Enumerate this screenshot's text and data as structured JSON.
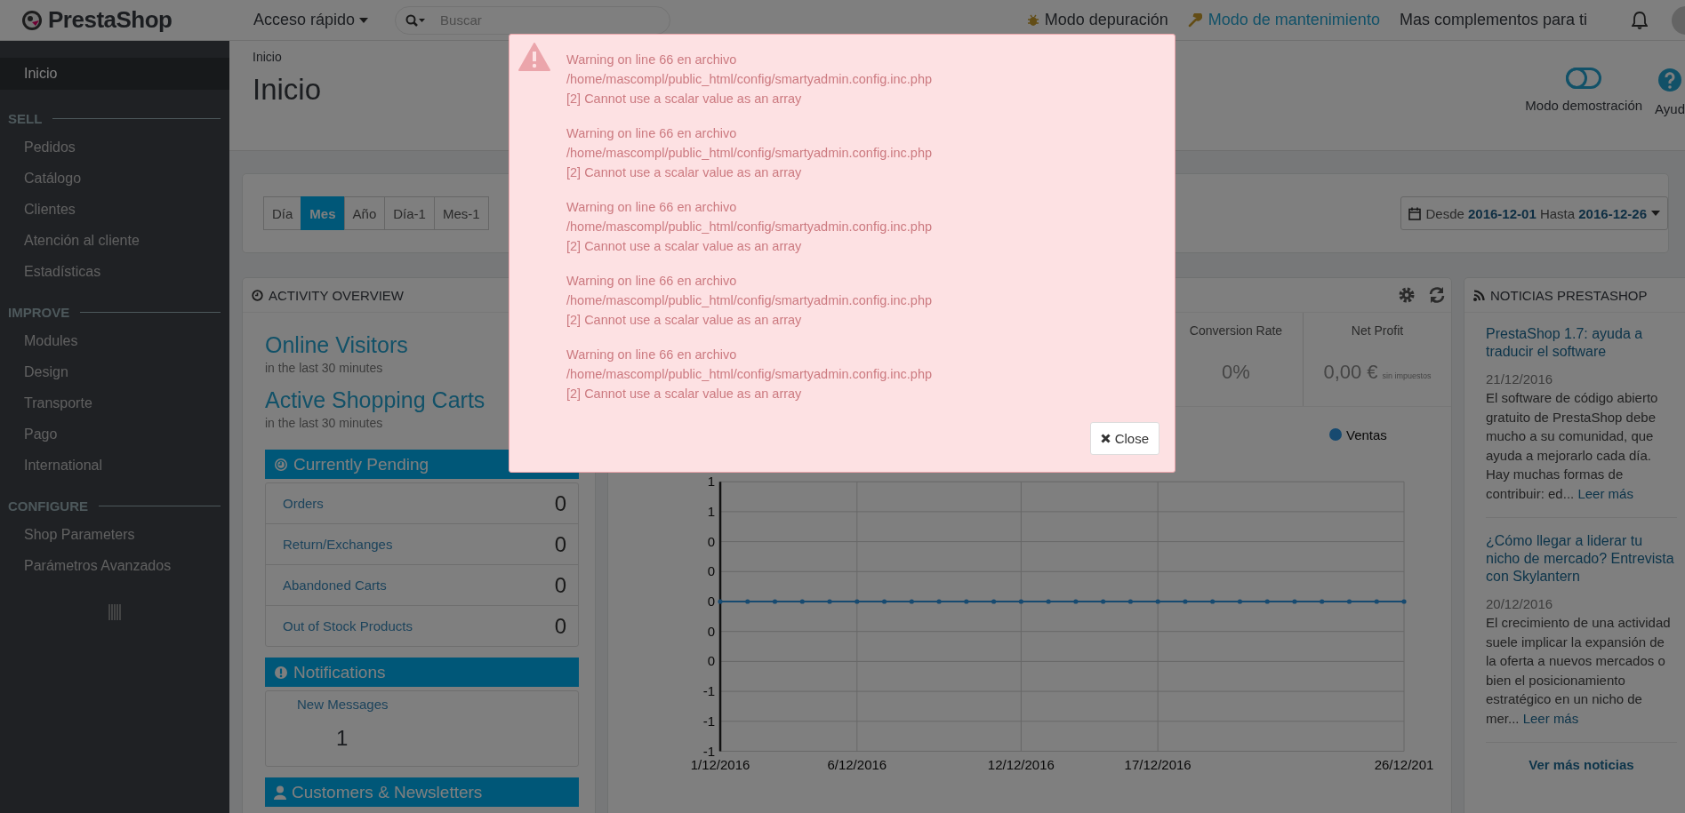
{
  "header": {
    "logo": "PrestaShop",
    "quick_access": "Acceso rápido",
    "search": {
      "placeholder": "Buscar"
    },
    "debug_mode": "Modo depuración",
    "maintenance_mode": "Modo de mantenimiento",
    "addons": "Mas complementos para ti"
  },
  "sidebar": [
    {
      "kind": "item",
      "label": "Inicio",
      "selected": true
    },
    {
      "kind": "section",
      "label": "SELL"
    },
    {
      "kind": "item",
      "label": "Pedidos",
      "selected": false
    },
    {
      "kind": "item",
      "label": "Catálogo",
      "selected": false
    },
    {
      "kind": "item",
      "label": "Clientes",
      "selected": false
    },
    {
      "kind": "item",
      "label": "Atención al cliente",
      "selected": false
    },
    {
      "kind": "item",
      "label": "Estadísticas",
      "selected": false
    },
    {
      "kind": "section",
      "label": "IMPROVE"
    },
    {
      "kind": "item",
      "label": "Modules",
      "selected": false
    },
    {
      "kind": "item",
      "label": "Design",
      "selected": false
    },
    {
      "kind": "item",
      "label": "Transporte",
      "selected": false
    },
    {
      "kind": "item",
      "label": "Pago",
      "selected": false
    },
    {
      "kind": "item",
      "label": "International",
      "selected": false
    },
    {
      "kind": "section",
      "label": "CONFIGURE"
    },
    {
      "kind": "item",
      "label": "Shop Parameters",
      "selected": false
    },
    {
      "kind": "item",
      "label": "Parámetros Avanzados",
      "selected": false
    }
  ],
  "page": {
    "breadcrumb": "Inicio",
    "title": "Inicio",
    "toolbar": [
      {
        "kind": "toggle",
        "label": "Modo demostración"
      },
      {
        "kind": "help",
        "label": "Ayud"
      }
    ]
  },
  "periods": [
    {
      "label": "Día",
      "selected": false
    },
    {
      "label": "Mes",
      "selected": true
    },
    {
      "label": "Año",
      "selected": false
    },
    {
      "label": "Día-1",
      "selected": false
    },
    {
      "label": "Mes-1",
      "selected": false
    }
  ],
  "date_range": "Desde **2016-12-01** Hasta **2016-12-26**",
  "activity": {
    "title": "ACTIVITY OVERVIEW",
    "metrics": [
      {
        "label": "Online Visitors",
        "note": "in the last 30 minutes"
      },
      {
        "label": "Active Shopping Carts",
        "note": "in the last 30 minutes"
      }
    ],
    "pending": {
      "title": "Currently Pending",
      "rows": [
        {
          "label": "Orders",
          "value": "0"
        },
        {
          "label": "Return/Exchanges",
          "value": "0"
        },
        {
          "label": "Abandoned Carts",
          "value": "0"
        },
        {
          "label": "Out of Stock Products",
          "value": "0"
        }
      ]
    },
    "notifications": {
      "title": "Notifications",
      "tab": "New Messages",
      "count": "1"
    },
    "customers": {
      "title": "Customers & Newsletters"
    }
  },
  "dashboard": {
    "stats": [
      {
        "label": "Conversion Rate",
        "value": "0%"
      },
      {
        "label": "Net Profit",
        "value": "0,00 €",
        "note": "sin impuestos"
      }
    ],
    "chart_data": {
      "type": "line",
      "grid": true,
      "categories": [
        "1/12/2016",
        null,
        null,
        null,
        null,
        "6/12/2016",
        null,
        null,
        null,
        null,
        null,
        "12/12/2016",
        null,
        null,
        null,
        null,
        "17/12/2016",
        null,
        null,
        null,
        null,
        null,
        null,
        null,
        null,
        "26/12/201"
      ],
      "series": [
        {
          "name": "Ventas",
          "color": "#174a70",
          "values": [
            0,
            0,
            0,
            0,
            0,
            0,
            0,
            0,
            0,
            0,
            0,
            0,
            0,
            0,
            0,
            0,
            0,
            0,
            0,
            0,
            0,
            0,
            0,
            0,
            0,
            0
          ]
        }
      ],
      "ylim": [
        -1,
        0.8
      ],
      "yticks": [
        {
          "value": 0.8,
          "label": "1"
        },
        {
          "value": 0.6,
          "label": "1"
        },
        {
          "value": 0.4,
          "label": "0"
        },
        {
          "value": 0.2,
          "label": "0"
        },
        {
          "value": 0,
          "label": "0"
        },
        {
          "value": -0.2,
          "label": "0"
        },
        {
          "value": -0.4,
          "label": "0"
        },
        {
          "value": -0.6,
          "label": "-1"
        },
        {
          "value": -0.8,
          "label": "-1"
        },
        {
          "value": -1,
          "label": "-1"
        }
      ]
    }
  },
  "news": {
    "title": "NOTICIAS PRESTASHOP",
    "items": [
      {
        "title": "PrestaShop 1.7: ayuda a traducir el software",
        "date": "21/12/2016",
        "text": "El software de código abierto gratuito de PrestaShop debe mucho a su comunidad, que ayuda a mejorarlo cada día. Hay muchas formas de contribuir: ed...",
        "more": "Leer más"
      },
      {
        "title": "¿Cómo llegar a liderar tu nicho de mercado? Entrevista con Skylantern",
        "date": "20/12/2016",
        "text": "El crecimiento de una actividad suele implicar la expansión de la oferta a nuevos mercados o bien el posicionamiento estratégico en un nicho de mer...",
        "more": "Leer más"
      }
    ],
    "footer": "Ver más noticias"
  },
  "modal": {
    "messages": [
      [
        "Warning on line 66 en archivo",
        "/home/mascompl/public_html/config/smartyadmin.config.inc.php",
        "[2] Cannot use a scalar value as an array"
      ],
      [
        "Warning on line 66 en archivo",
        "/home/mascompl/public_html/config/smartyadmin.config.inc.php",
        "[2] Cannot use a scalar value as an array"
      ],
      [
        "Warning on line 66 en archivo",
        "/home/mascompl/public_html/config/smartyadmin.config.inc.php",
        "[2] Cannot use a scalar value as an array"
      ],
      [
        "Warning on line 66 en archivo",
        "/home/mascompl/public_html/config/smartyadmin.config.inc.php",
        "[2] Cannot use a scalar value as an array"
      ],
      [
        "Warning on line 66 en archivo",
        "/home/mascompl/public_html/config/smartyadmin.config.inc.php",
        "[2] Cannot use a scalar value as an array"
      ]
    ],
    "close": "Close"
  }
}
